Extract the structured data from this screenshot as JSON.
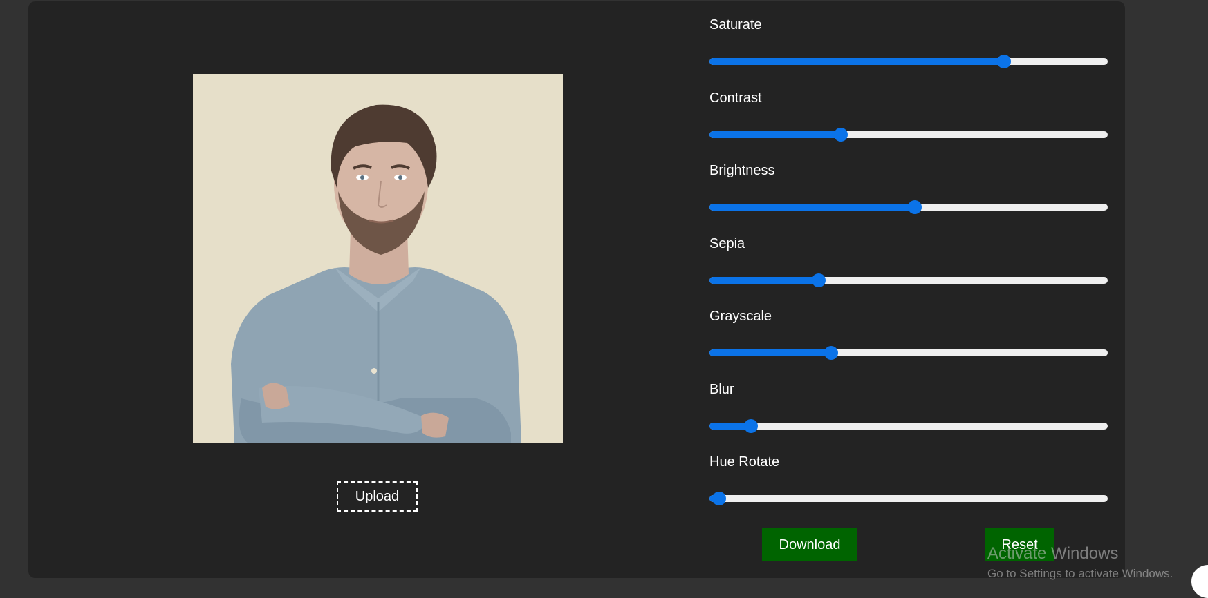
{
  "preview": {
    "image": "portrait of bearded man in denim shirt with crossed arms",
    "background_color": "#e6dfc9"
  },
  "upload": {
    "label": "Upload"
  },
  "filters": [
    {
      "id": "saturate",
      "label": "Saturate",
      "value": 0.74
    },
    {
      "id": "contrast",
      "label": "Contrast",
      "value": 0.33
    },
    {
      "id": "brightness",
      "label": "Brightness",
      "value": 0.515
    },
    {
      "id": "sepia",
      "label": "Sepia",
      "value": 0.275
    },
    {
      "id": "grayscale",
      "label": "Grayscale",
      "value": 0.305
    },
    {
      "id": "blur",
      "label": "Blur",
      "value": 0.105
    },
    {
      "id": "hue-rotate",
      "label": "Hue Rotate",
      "value": 0.025
    }
  ],
  "actions": {
    "download_label": "Download",
    "reset_label": "Reset"
  },
  "watermark": {
    "title": "Activate Windows",
    "subtitle": "Go to Settings to activate Windows."
  },
  "colors": {
    "page_bg": "#323232",
    "card_bg": "#232323",
    "accent": "#0b73e8",
    "track": "#efefef",
    "button_bg": "#006400"
  }
}
